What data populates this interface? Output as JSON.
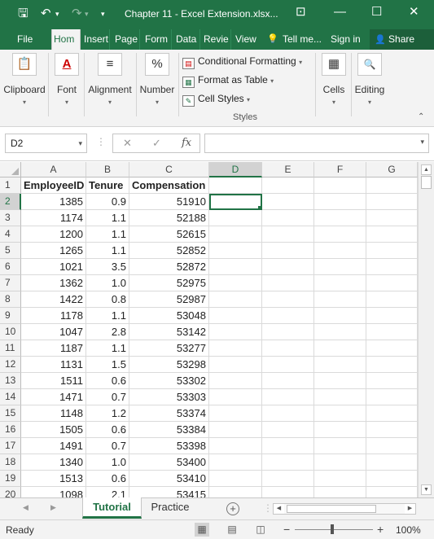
{
  "title_bar": {
    "title": "Chapter 11 - Excel Extension.xlsx...",
    "save_icon": "save-icon",
    "undo_icon": "undo-icon",
    "redo_icon": "redo-icon",
    "customize_icon": "customize-qat-icon",
    "ribbon_display_icon": "ribbon-display-options-icon",
    "minimize_icon": "minimize-icon",
    "maximize_icon": "maximize-icon",
    "close_icon": "close-icon",
    "save_glyph": "🖫",
    "undo_glyph": "↶",
    "redo_glyph": "↷",
    "customize_glyph": "▾",
    "ribbon_display_glyph": "⊡",
    "minimize_glyph": "—",
    "maximize_glyph": "☐",
    "close_glyph": "✕"
  },
  "tabs": {
    "file": "File",
    "home": "Hom",
    "insert": "Insert",
    "page": "Page",
    "form": "Form",
    "data": "Data",
    "review": "Revie",
    "view": "View",
    "tell_me": "Tell me...",
    "sign_in": "Sign in",
    "share": "Share",
    "tell_me_icon": "lightbulb-icon",
    "tell_me_glyph": "💡",
    "share_glyph": "👤"
  },
  "ribbon": {
    "clipboard": "Clipboard",
    "font": "Font",
    "alignment": "Alignment",
    "number": "Number",
    "conditional_formatting": "Conditional Formatting",
    "format_as_table": "Format as Table",
    "cell_styles": "Cell Styles",
    "styles_group": "Styles",
    "cells": "Cells",
    "editing": "Editing",
    "clipboard_glyph": "📋",
    "font_glyph": "A",
    "alignment_glyph": "≡",
    "number_glyph": "%",
    "cells_glyph": "▦",
    "editing_glyph": "🔍",
    "caret_glyph": "▾",
    "dropdown_glyph": "▾",
    "collapse_glyph": "⌃"
  },
  "formula_bar": {
    "name_box": "D2",
    "formula": "",
    "cancel_glyph": "✕",
    "enter_glyph": "✓",
    "fx": "fx",
    "dropdown_glyph": "▾",
    "dots": "⋮"
  },
  "grid": {
    "columns": [
      "A",
      "B",
      "C",
      "D",
      "E",
      "F",
      "G"
    ],
    "selected_column": "D",
    "selected_row": "2",
    "active_cell": "D2",
    "headers": [
      "EmployeeID",
      "Tenure",
      "Compensation"
    ],
    "rows": [
      {
        "n": "1",
        "a": "EmployeeID",
        "b": "Tenure",
        "c": "Compensation"
      },
      {
        "n": "2",
        "a": "1385",
        "b": "0.9",
        "c": "51910"
      },
      {
        "n": "3",
        "a": "1174",
        "b": "1.1",
        "c": "52188"
      },
      {
        "n": "4",
        "a": "1200",
        "b": "1.1",
        "c": "52615"
      },
      {
        "n": "5",
        "a": "1265",
        "b": "1.1",
        "c": "52852"
      },
      {
        "n": "6",
        "a": "1021",
        "b": "3.5",
        "c": "52872"
      },
      {
        "n": "7",
        "a": "1362",
        "b": "1.0",
        "c": "52975"
      },
      {
        "n": "8",
        "a": "1422",
        "b": "0.8",
        "c": "52987"
      },
      {
        "n": "9",
        "a": "1178",
        "b": "1.1",
        "c": "53048"
      },
      {
        "n": "10",
        "a": "1047",
        "b": "2.8",
        "c": "53142"
      },
      {
        "n": "11",
        "a": "1187",
        "b": "1.1",
        "c": "53277"
      },
      {
        "n": "12",
        "a": "1131",
        "b": "1.5",
        "c": "53298"
      },
      {
        "n": "13",
        "a": "1511",
        "b": "0.6",
        "c": "53302"
      },
      {
        "n": "14",
        "a": "1471",
        "b": "0.7",
        "c": "53303"
      },
      {
        "n": "15",
        "a": "1148",
        "b": "1.2",
        "c": "53374"
      },
      {
        "n": "16",
        "a": "1505",
        "b": "0.6",
        "c": "53384"
      },
      {
        "n": "17",
        "a": "1491",
        "b": "0.7",
        "c": "53398"
      },
      {
        "n": "18",
        "a": "1340",
        "b": "1.0",
        "c": "53400"
      },
      {
        "n": "19",
        "a": "1513",
        "b": "0.6",
        "c": "53410"
      },
      {
        "n": "20",
        "a": "1098",
        "b": "2.1",
        "c": "53415"
      }
    ]
  },
  "sheets": {
    "tabs": [
      "Tutorial",
      "Practice"
    ],
    "active": "Tutorial",
    "add_glyph": "+",
    "prev_glyph": "◀",
    "next_glyph": "▶",
    "more_glyph": "⋮"
  },
  "status_bar": {
    "status": "Ready",
    "zoom": "100%",
    "zoom_minus": "−",
    "zoom_plus": "+",
    "normal_view_glyph": "▦",
    "page_layout_glyph": "▤",
    "page_break_glyph": "◫"
  },
  "colors": {
    "accent": "#217346",
    "ribbon_bg": "#f3f3f3",
    "gridline": "#dadada"
  }
}
